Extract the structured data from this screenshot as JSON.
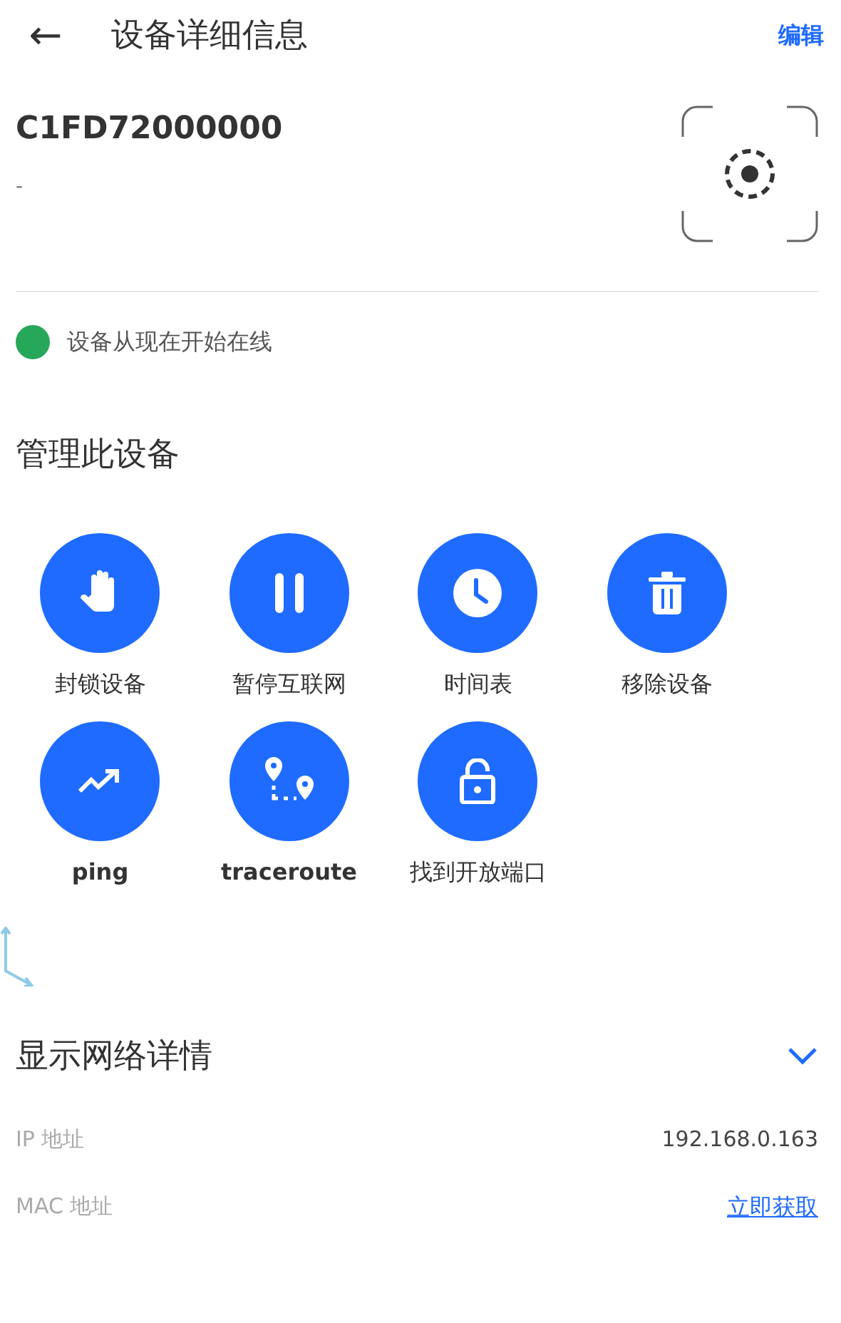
{
  "header": {
    "back": "←",
    "title": "设备详细信息",
    "action": "编辑"
  },
  "device": {
    "name": "C1FD72000000",
    "subtitle": "-"
  },
  "status": {
    "text": "设备从现在开始在线",
    "color": "#27a75a"
  },
  "manage": {
    "title": "管理此设备",
    "actions": [
      {
        "kind": "hand",
        "label": "封锁设备",
        "bold": false
      },
      {
        "kind": "pause",
        "label": "暂停互联网",
        "bold": false
      },
      {
        "kind": "clock",
        "label": "时间表",
        "bold": false
      },
      {
        "kind": "trash",
        "label": "移除设备",
        "bold": false
      },
      {
        "kind": "trend",
        "label": "ping",
        "bold": true
      },
      {
        "kind": "route",
        "label": "traceroute",
        "bold": true
      },
      {
        "kind": "lock",
        "label": "找到开放端口",
        "bold": false
      }
    ]
  },
  "network": {
    "title": "显示网络详情",
    "rows": [
      {
        "label": "IP 地址",
        "value": "192.168.0.163",
        "kind": "text"
      },
      {
        "label": "MAC 地址",
        "value": "立即获取",
        "kind": "link"
      }
    ]
  }
}
